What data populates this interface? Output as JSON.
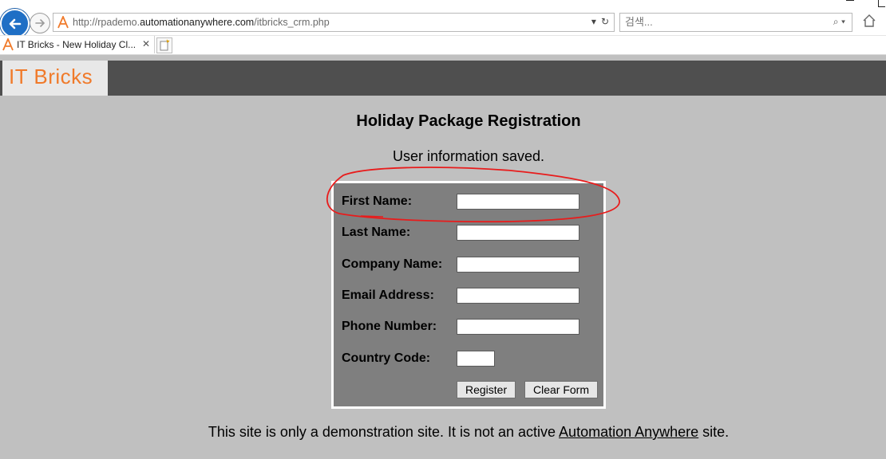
{
  "browser": {
    "url_prefix": "http://rpademo.",
    "url_host": "automationanywhere.com",
    "url_path": "/itbricks_crm.php",
    "search_placeholder": "검색...",
    "tab_title": "IT Bricks - New Holiday Cl...",
    "tab_close": "✕",
    "address_tools": [
      "▾",
      "↻"
    ],
    "search_tools": "⌕ ▾"
  },
  "site": {
    "logo": "IT Bricks",
    "logo_color": "#f07a2a"
  },
  "page": {
    "title": "Holiday Package Registration",
    "status": "User information saved."
  },
  "form": {
    "first_name_label": "First Name:",
    "last_name_label": "Last Name:",
    "company_label": "Company Name:",
    "email_label": "Email Address:",
    "phone_label": "Phone Number:",
    "country_label": "Country Code:",
    "first_name_value": "",
    "last_name_value": "",
    "company_value": "",
    "email_value": "",
    "phone_value": "",
    "country_value": "",
    "register_label": "Register",
    "clear_label": "Clear Form"
  },
  "footer": {
    "text_before": "This site is only a demonstration site. It is not an active ",
    "link_text": "Automation Anywhere",
    "text_after": " site."
  },
  "colors": {
    "page_bg": "#c0c0c0",
    "header_bg": "#4f4f4f",
    "form_bg": "#7f7f7f",
    "annotation": "#e81c1c"
  }
}
